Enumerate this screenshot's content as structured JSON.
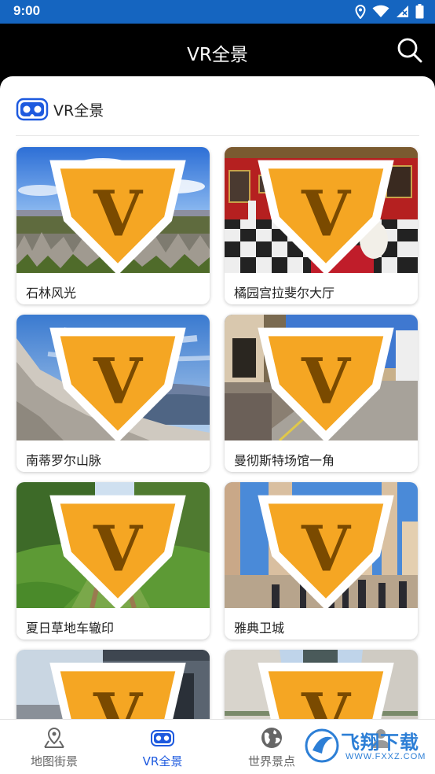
{
  "status_bar": {
    "time": "9:00",
    "icons": [
      "location-icon",
      "wifi-icon",
      "signal-icon",
      "battery-icon"
    ],
    "background": "#1565c0"
  },
  "app_bar": {
    "title": "VR全景",
    "search_icon": "search-icon"
  },
  "section": {
    "title": "VR全景",
    "icon": "vr-goggles-icon"
  },
  "cards": [
    {
      "label": "石林风光"
    },
    {
      "label": "橘园宫拉斐尔大厅"
    },
    {
      "label": "南蒂罗尔山脉"
    },
    {
      "label": "曼彻斯特场馆一角"
    },
    {
      "label": "夏日草地车辙印"
    },
    {
      "label": "雅典卫城"
    },
    {
      "label": ""
    },
    {
      "label": ""
    }
  ],
  "bottom_nav": {
    "items": [
      {
        "label": "地图街景",
        "icon": "map-pin-icon"
      },
      {
        "label": "VR全景",
        "icon": "vr-goggles-icon",
        "active": true
      },
      {
        "label": "世界景点",
        "icon": "globe-icon"
      },
      {
        "label": "",
        "icon": "person-icon"
      }
    ]
  },
  "watermark": {
    "text": "飞翔下载",
    "sub": "WWW.FXXZ.COM"
  },
  "colors": {
    "accent": "#1e5adf",
    "badge": "#f5a623",
    "app_bar": "#000000"
  }
}
